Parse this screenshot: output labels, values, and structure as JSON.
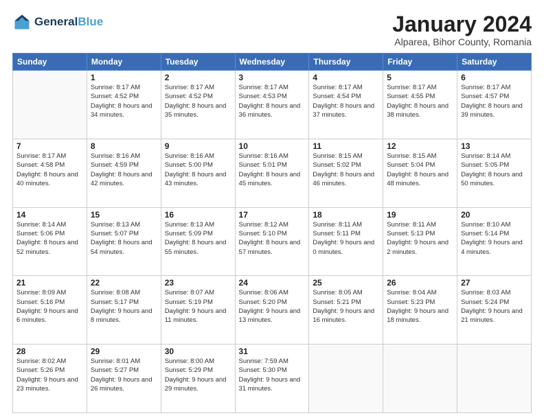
{
  "header": {
    "logo_line1": "General",
    "logo_line2": "Blue",
    "month_title": "January 2024",
    "subtitle": "Alparea, Bihor County, Romania"
  },
  "weekdays": [
    "Sunday",
    "Monday",
    "Tuesday",
    "Wednesday",
    "Thursday",
    "Friday",
    "Saturday"
  ],
  "weeks": [
    [
      {
        "day": "",
        "sunrise": "",
        "sunset": "",
        "daylight": ""
      },
      {
        "day": "1",
        "sunrise": "Sunrise: 8:17 AM",
        "sunset": "Sunset: 4:52 PM",
        "daylight": "Daylight: 8 hours and 34 minutes."
      },
      {
        "day": "2",
        "sunrise": "Sunrise: 8:17 AM",
        "sunset": "Sunset: 4:52 PM",
        "daylight": "Daylight: 8 hours and 35 minutes."
      },
      {
        "day": "3",
        "sunrise": "Sunrise: 8:17 AM",
        "sunset": "Sunset: 4:53 PM",
        "daylight": "Daylight: 8 hours and 36 minutes."
      },
      {
        "day": "4",
        "sunrise": "Sunrise: 8:17 AM",
        "sunset": "Sunset: 4:54 PM",
        "daylight": "Daylight: 8 hours and 37 minutes."
      },
      {
        "day": "5",
        "sunrise": "Sunrise: 8:17 AM",
        "sunset": "Sunset: 4:55 PM",
        "daylight": "Daylight: 8 hours and 38 minutes."
      },
      {
        "day": "6",
        "sunrise": "Sunrise: 8:17 AM",
        "sunset": "Sunset: 4:57 PM",
        "daylight": "Daylight: 8 hours and 39 minutes."
      }
    ],
    [
      {
        "day": "7",
        "sunrise": "Sunrise: 8:17 AM",
        "sunset": "Sunset: 4:58 PM",
        "daylight": "Daylight: 8 hours and 40 minutes."
      },
      {
        "day": "8",
        "sunrise": "Sunrise: 8:16 AM",
        "sunset": "Sunset: 4:59 PM",
        "daylight": "Daylight: 8 hours and 42 minutes."
      },
      {
        "day": "9",
        "sunrise": "Sunrise: 8:16 AM",
        "sunset": "Sunset: 5:00 PM",
        "daylight": "Daylight: 8 hours and 43 minutes."
      },
      {
        "day": "10",
        "sunrise": "Sunrise: 8:16 AM",
        "sunset": "Sunset: 5:01 PM",
        "daylight": "Daylight: 8 hours and 45 minutes."
      },
      {
        "day": "11",
        "sunrise": "Sunrise: 8:15 AM",
        "sunset": "Sunset: 5:02 PM",
        "daylight": "Daylight: 8 hours and 46 minutes."
      },
      {
        "day": "12",
        "sunrise": "Sunrise: 8:15 AM",
        "sunset": "Sunset: 5:04 PM",
        "daylight": "Daylight: 8 hours and 48 minutes."
      },
      {
        "day": "13",
        "sunrise": "Sunrise: 8:14 AM",
        "sunset": "Sunset: 5:05 PM",
        "daylight": "Daylight: 8 hours and 50 minutes."
      }
    ],
    [
      {
        "day": "14",
        "sunrise": "Sunrise: 8:14 AM",
        "sunset": "Sunset: 5:06 PM",
        "daylight": "Daylight: 8 hours and 52 minutes."
      },
      {
        "day": "15",
        "sunrise": "Sunrise: 8:13 AM",
        "sunset": "Sunset: 5:07 PM",
        "daylight": "Daylight: 8 hours and 54 minutes."
      },
      {
        "day": "16",
        "sunrise": "Sunrise: 8:13 AM",
        "sunset": "Sunset: 5:09 PM",
        "daylight": "Daylight: 8 hours and 55 minutes."
      },
      {
        "day": "17",
        "sunrise": "Sunrise: 8:12 AM",
        "sunset": "Sunset: 5:10 PM",
        "daylight": "Daylight: 8 hours and 57 minutes."
      },
      {
        "day": "18",
        "sunrise": "Sunrise: 8:11 AM",
        "sunset": "Sunset: 5:11 PM",
        "daylight": "Daylight: 9 hours and 0 minutes."
      },
      {
        "day": "19",
        "sunrise": "Sunrise: 8:11 AM",
        "sunset": "Sunset: 5:13 PM",
        "daylight": "Daylight: 9 hours and 2 minutes."
      },
      {
        "day": "20",
        "sunrise": "Sunrise: 8:10 AM",
        "sunset": "Sunset: 5:14 PM",
        "daylight": "Daylight: 9 hours and 4 minutes."
      }
    ],
    [
      {
        "day": "21",
        "sunrise": "Sunrise: 8:09 AM",
        "sunset": "Sunset: 5:16 PM",
        "daylight": "Daylight: 9 hours and 6 minutes."
      },
      {
        "day": "22",
        "sunrise": "Sunrise: 8:08 AM",
        "sunset": "Sunset: 5:17 PM",
        "daylight": "Daylight: 9 hours and 8 minutes."
      },
      {
        "day": "23",
        "sunrise": "Sunrise: 8:07 AM",
        "sunset": "Sunset: 5:19 PM",
        "daylight": "Daylight: 9 hours and 11 minutes."
      },
      {
        "day": "24",
        "sunrise": "Sunrise: 8:06 AM",
        "sunset": "Sunset: 5:20 PM",
        "daylight": "Daylight: 9 hours and 13 minutes."
      },
      {
        "day": "25",
        "sunrise": "Sunrise: 8:05 AM",
        "sunset": "Sunset: 5:21 PM",
        "daylight": "Daylight: 9 hours and 16 minutes."
      },
      {
        "day": "26",
        "sunrise": "Sunrise: 8:04 AM",
        "sunset": "Sunset: 5:23 PM",
        "daylight": "Daylight: 9 hours and 18 minutes."
      },
      {
        "day": "27",
        "sunrise": "Sunrise: 8:03 AM",
        "sunset": "Sunset: 5:24 PM",
        "daylight": "Daylight: 9 hours and 21 minutes."
      }
    ],
    [
      {
        "day": "28",
        "sunrise": "Sunrise: 8:02 AM",
        "sunset": "Sunset: 5:26 PM",
        "daylight": "Daylight: 9 hours and 23 minutes."
      },
      {
        "day": "29",
        "sunrise": "Sunrise: 8:01 AM",
        "sunset": "Sunset: 5:27 PM",
        "daylight": "Daylight: 9 hours and 26 minutes."
      },
      {
        "day": "30",
        "sunrise": "Sunrise: 8:00 AM",
        "sunset": "Sunset: 5:29 PM",
        "daylight": "Daylight: 9 hours and 29 minutes."
      },
      {
        "day": "31",
        "sunrise": "Sunrise: 7:59 AM",
        "sunset": "Sunset: 5:30 PM",
        "daylight": "Daylight: 9 hours and 31 minutes."
      },
      {
        "day": "",
        "sunrise": "",
        "sunset": "",
        "daylight": ""
      },
      {
        "day": "",
        "sunrise": "",
        "sunset": "",
        "daylight": ""
      },
      {
        "day": "",
        "sunrise": "",
        "sunset": "",
        "daylight": ""
      }
    ]
  ]
}
